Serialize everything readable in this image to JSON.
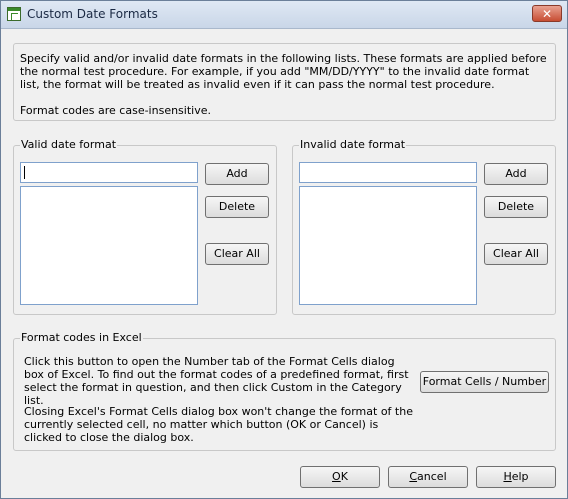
{
  "window": {
    "title": "Custom Date Formats",
    "close_glyph": "✕"
  },
  "info": {
    "paragraph1": "Specify valid and/or invalid date formats in the following lists. These formats are applied before the normal test procedure. For example, if you add \"MM/DD/YYYY\" to the invalid date format list, the format will be treated as invalid even if it can pass the normal test procedure.",
    "paragraph2": "Format codes are case-insensitive."
  },
  "valid_group": {
    "label": "Valid date format",
    "input_value": "",
    "add_label": "Add",
    "delete_label": "Delete",
    "clear_label": "Clear All",
    "items": []
  },
  "invalid_group": {
    "label": "Invalid date format",
    "input_value": "",
    "add_label": "Add",
    "delete_label": "Delete",
    "clear_label": "Clear All",
    "items": []
  },
  "excel_group": {
    "label": "Format codes in Excel",
    "text1": "Click this button to open the Number tab of the Format Cells dialog box of Excel. To find out the format codes of a predefined format, first select the format in question, and then click Custom in the Category list.",
    "text2": "Closing Excel's Format Cells dialog box won't change the format of the currently selected cell, no matter which button (OK or Cancel) is clicked to close the dialog box.",
    "button_label": "Format Cells / Number"
  },
  "footer": {
    "ok_label": "OK",
    "cancel_label": "Cancel",
    "help_label": "Help"
  }
}
